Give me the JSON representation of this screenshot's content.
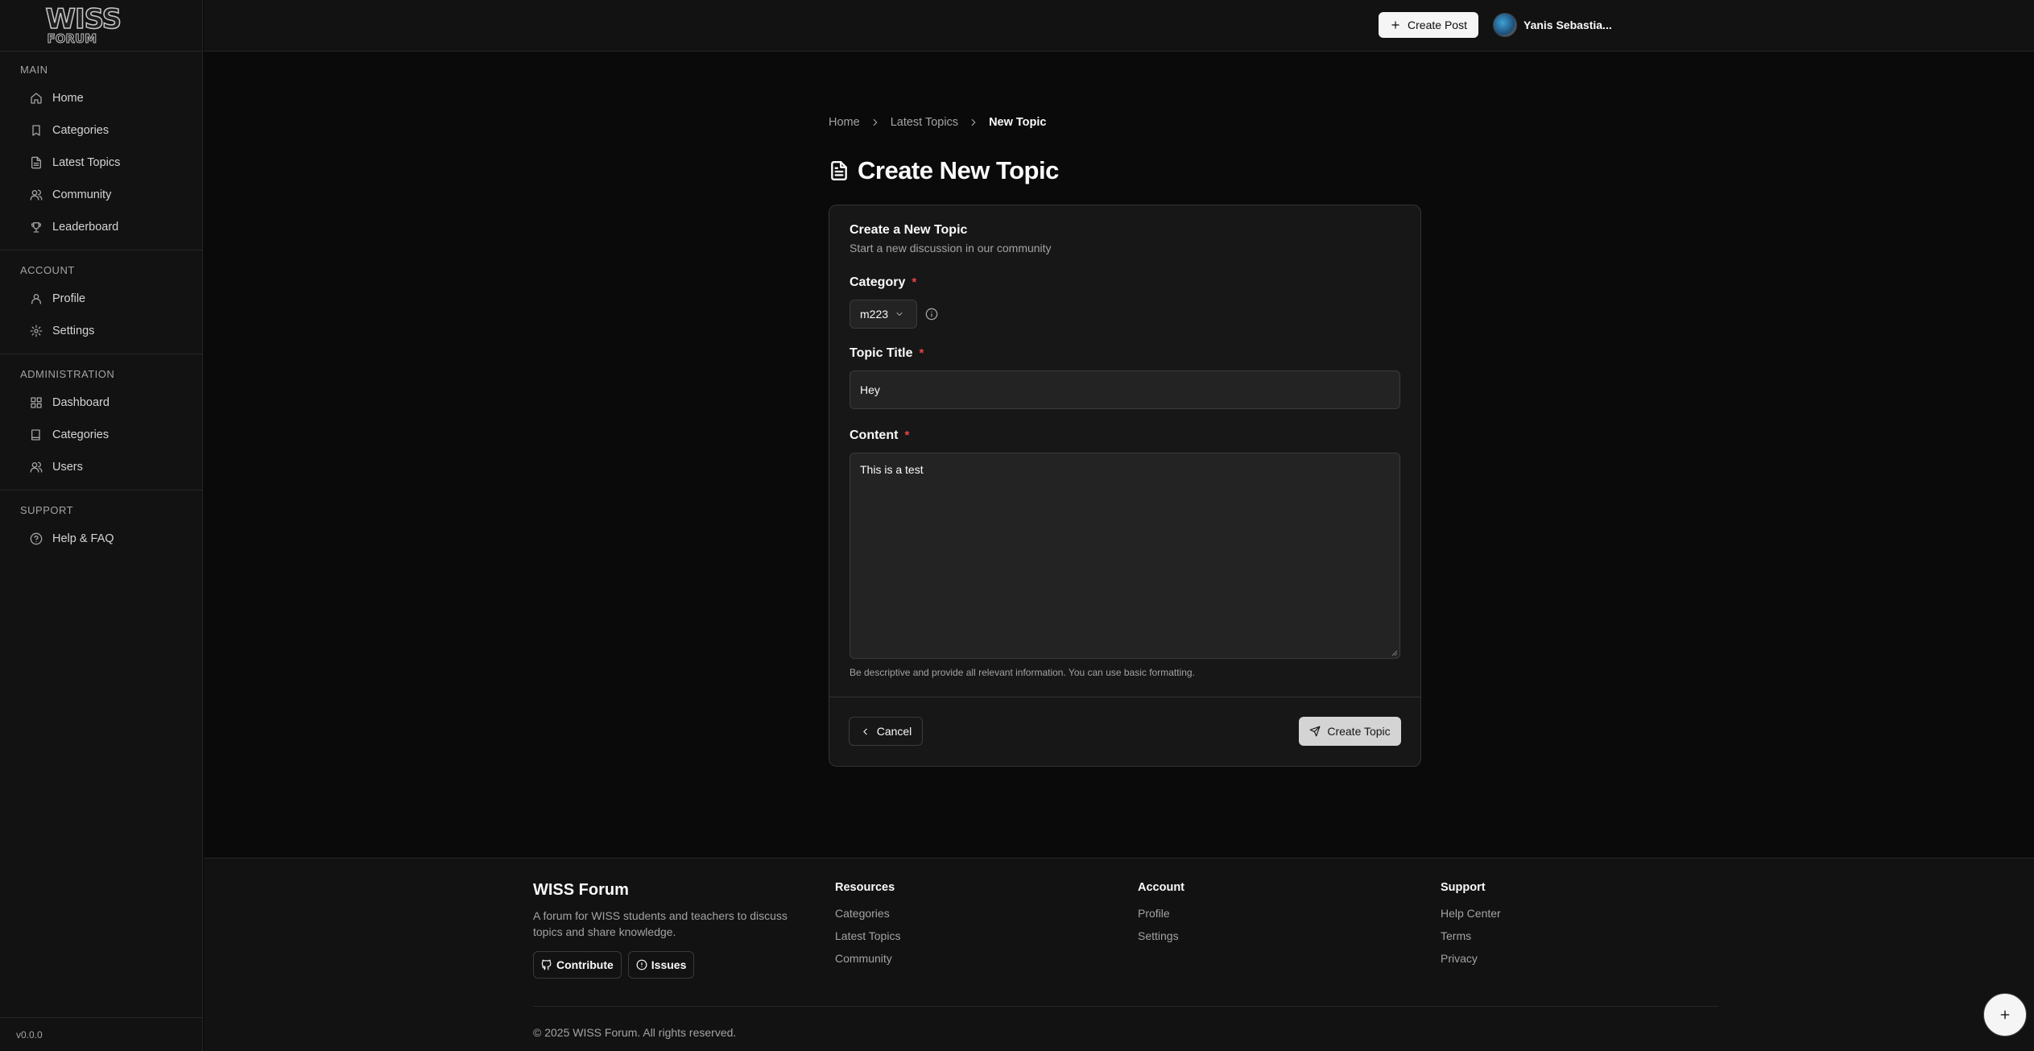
{
  "app": {
    "logo_text_top": "WISS",
    "logo_text_bottom": "FORUM",
    "version": "v0.0.0"
  },
  "sidebar": {
    "sections": [
      {
        "heading": "MAIN",
        "items": [
          {
            "label": "Home",
            "icon": "home-icon"
          },
          {
            "label": "Categories",
            "icon": "bookmark-icon"
          },
          {
            "label": "Latest Topics",
            "icon": "file-icon"
          },
          {
            "label": "Community",
            "icon": "users-icon"
          },
          {
            "label": "Leaderboard",
            "icon": "trophy-icon"
          }
        ]
      },
      {
        "heading": "ACCOUNT",
        "items": [
          {
            "label": "Profile",
            "icon": "user-icon"
          },
          {
            "label": "Settings",
            "icon": "gear-icon"
          }
        ]
      },
      {
        "heading": "ADMINISTRATION",
        "items": [
          {
            "label": "Dashboard",
            "icon": "grid-icon"
          },
          {
            "label": "Categories",
            "icon": "book-icon"
          },
          {
            "label": "Users",
            "icon": "users-icon"
          }
        ]
      },
      {
        "heading": "SUPPORT",
        "items": [
          {
            "label": "Help & FAQ",
            "icon": "help-circle-icon"
          }
        ]
      }
    ]
  },
  "header": {
    "create_post_label": "Create Post",
    "user_name": "Yanis Sebastia..."
  },
  "breadcrumb": {
    "home": "Home",
    "latest": "Latest Topics",
    "current": "New Topic"
  },
  "page": {
    "title": "Create New Topic"
  },
  "form": {
    "card_title": "Create a New Topic",
    "card_subtitle": "Start a new discussion in our community",
    "category_label": "Category",
    "category_value": "m223",
    "title_label": "Topic Title",
    "title_value": "Hey",
    "content_label": "Content",
    "content_value": "This is a test",
    "required_marker": "*",
    "hint": "Be descriptive and provide all relevant information. You can use basic formatting.",
    "cancel_label": "Cancel",
    "submit_label": "Create Topic"
  },
  "footer": {
    "brand": "WISS Forum",
    "description": "A forum for WISS students and teachers to discuss topics and share knowledge.",
    "contribute_label": "Contribute",
    "issues_label": "Issues",
    "resources": {
      "heading": "Resources",
      "links": [
        "Categories",
        "Latest Topics",
        "Community"
      ]
    },
    "account": {
      "heading": "Account",
      "links": [
        "Profile",
        "Settings"
      ]
    },
    "support": {
      "heading": "Support",
      "links": [
        "Help Center",
        "Terms",
        "Privacy"
      ]
    },
    "copyright": "© 2025 WISS Forum. All rights reserved."
  },
  "colors": {
    "background": "#0a0a0a",
    "panel": "#121212",
    "card": "#171717",
    "required": "#ef4444",
    "primary_button": "#f5f5f5"
  }
}
